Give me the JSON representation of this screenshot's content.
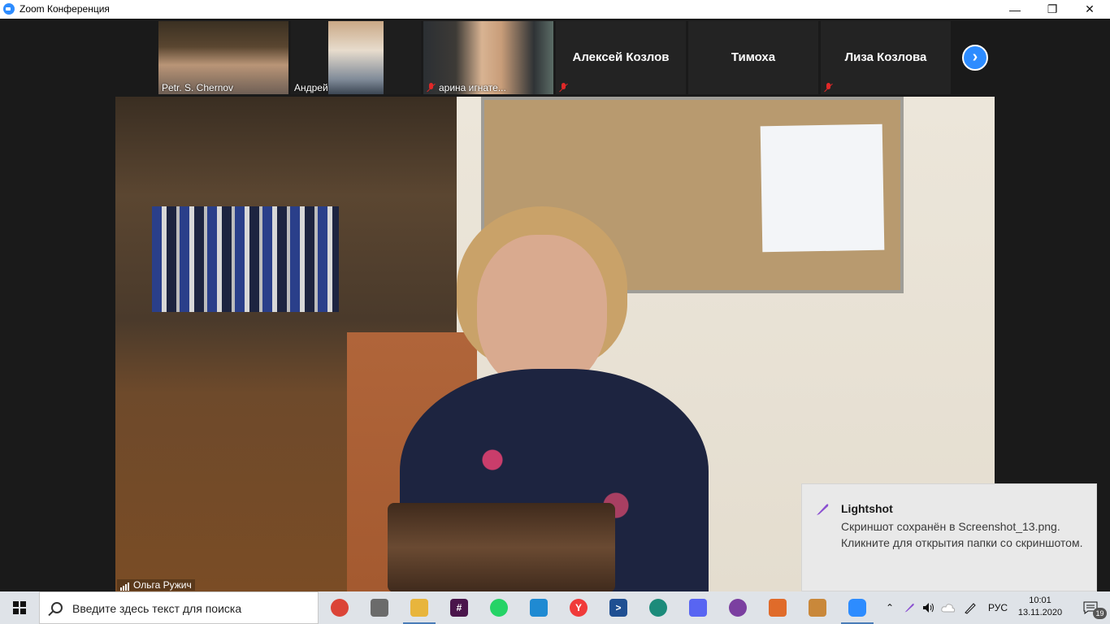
{
  "window": {
    "title": "Zoom Конференция",
    "controls": {
      "minimize": "—",
      "maximize": "❐",
      "close": "✕"
    }
  },
  "participants": [
    {
      "name": "Petr. S. Chernov",
      "video": true,
      "muted": false
    },
    {
      "name": "Андрей",
      "video": true,
      "muted": false
    },
    {
      "name": "арина игнате...",
      "video": true,
      "muted": true
    },
    {
      "name": "Алексей Козлов",
      "video": false,
      "muted": true
    },
    {
      "name": "Тимоха",
      "video": false,
      "muted": false
    },
    {
      "name": "Лиза Козлова",
      "video": false,
      "muted": true
    }
  ],
  "next_page_glyph": "›",
  "active_speaker": {
    "name": "Ольга Ружич"
  },
  "toast": {
    "title": "Lightshot",
    "body": "Скриншот сохранён в Screenshot_13.png. Кликните для открытия папки со скриншотом."
  },
  "taskbar": {
    "search_placeholder": "Введите здесь текст для поиска",
    "apps": [
      {
        "name": "chrome",
        "icon": "chrome-icon",
        "color": "#db4437",
        "glyph": ""
      },
      {
        "name": "screenshot-tool",
        "icon": "camera-icon",
        "color": "#6b6b6b",
        "glyph": ""
      },
      {
        "name": "file-explorer",
        "icon": "folder-icon",
        "color": "#e8b53c",
        "glyph": ""
      },
      {
        "name": "slack",
        "icon": "slack-icon",
        "color": "#4a154b",
        "glyph": "#"
      },
      {
        "name": "whatsapp",
        "icon": "whatsapp-icon",
        "color": "#25d366",
        "glyph": ""
      },
      {
        "name": "vscode",
        "icon": "vscode-icon",
        "color": "#1f8ad2",
        "glyph": ""
      },
      {
        "name": "yandex-browser",
        "icon": "yandex-icon",
        "color": "#f03a3a",
        "glyph": "Y"
      },
      {
        "name": "powershell",
        "icon": "powershell-icon",
        "color": "#1f4f92",
        "glyph": ">"
      },
      {
        "name": "edge",
        "icon": "edge-icon",
        "color": "#1c8b7a",
        "glyph": ""
      },
      {
        "name": "discord",
        "icon": "discord-icon",
        "color": "#5865f2",
        "glyph": ""
      },
      {
        "name": "app-purple",
        "icon": "purple-app-icon",
        "color": "#7b3fa0",
        "glyph": ""
      },
      {
        "name": "office-doc",
        "icon": "document-icon",
        "color": "#e06b2a",
        "glyph": ""
      },
      {
        "name": "paint",
        "icon": "paint-icon",
        "color": "#c9883a",
        "glyph": ""
      },
      {
        "name": "zoom",
        "icon": "zoom-icon",
        "color": "#2d8cff",
        "glyph": "",
        "active": true
      }
    ],
    "tray": {
      "chevron": "⌃",
      "language": "РУС",
      "time": "10:01",
      "date": "13.11.2020",
      "notifications_count": "19"
    }
  }
}
